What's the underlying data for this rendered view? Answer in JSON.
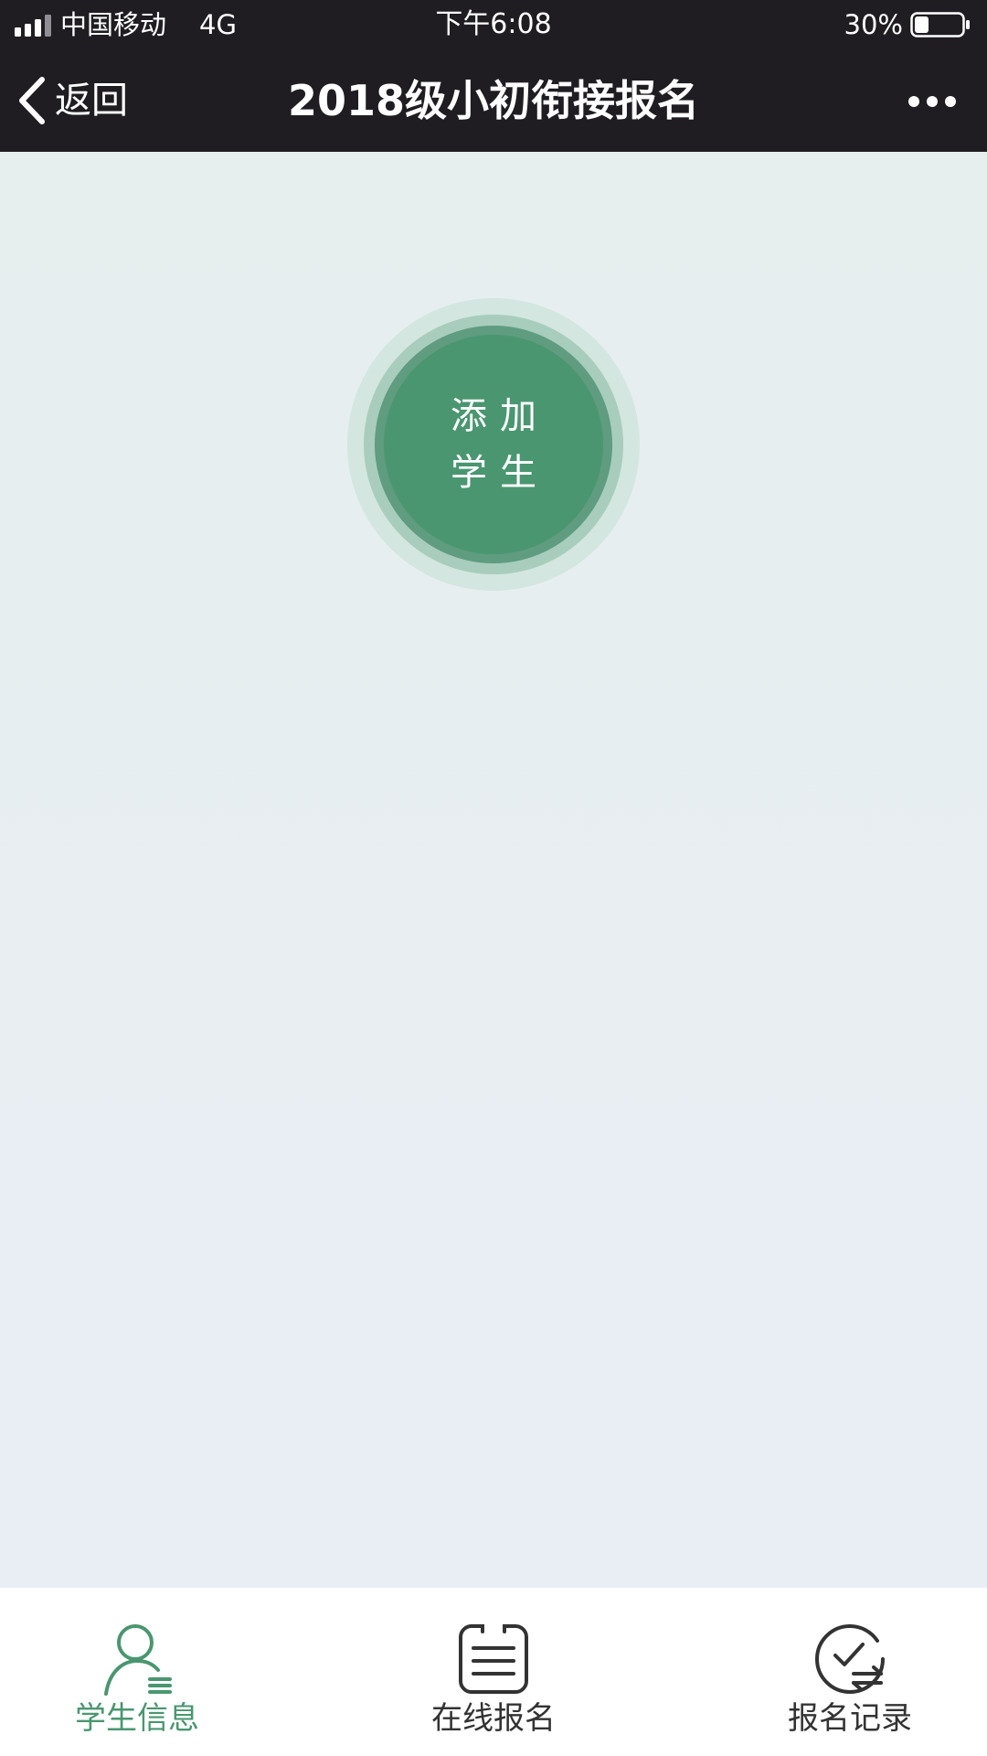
{
  "status_bar": {
    "carrier": "中国移动",
    "network": "4G",
    "time": "下午6:08",
    "battery_percent": "30%",
    "battery_level": 0.3
  },
  "nav_bar": {
    "back_label": "返回",
    "title": "2018级小初衔接报名"
  },
  "main": {
    "add_student_line1": "添加",
    "add_student_line2": "学生"
  },
  "tabs": [
    {
      "label": "学生信息",
      "active": true,
      "icon": "person-list-icon"
    },
    {
      "label": "在线报名",
      "active": false,
      "icon": "clipboard-icon"
    },
    {
      "label": "报名记录",
      "active": false,
      "icon": "check-refresh-icon"
    }
  ],
  "colors": {
    "bar_dark": "#1f1d21",
    "accent_green": "#4a9670",
    "tab_inactive": "#333333",
    "content_bg": "#e9eef3"
  }
}
